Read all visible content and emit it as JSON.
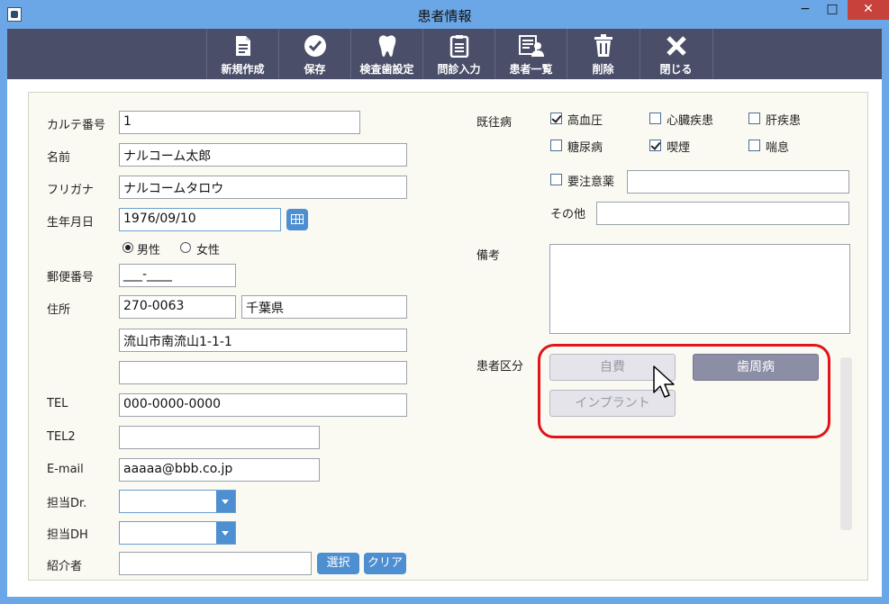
{
  "window": {
    "title": "患者情報"
  },
  "titlebar": {
    "minimize": "−",
    "maximize": "□",
    "close": "✕"
  },
  "toolbar": {
    "items": [
      {
        "label": "新規作成",
        "icon": "new-document-icon"
      },
      {
        "label": "保存",
        "icon": "check-circle-icon"
      },
      {
        "label": "検査歯設定",
        "icon": "tooth-icon"
      },
      {
        "label": "問診入力",
        "icon": "clipboard-icon"
      },
      {
        "label": "患者一覧",
        "icon": "patient-list-icon"
      },
      {
        "label": "削除",
        "icon": "trash-icon"
      },
      {
        "label": "閉じる",
        "icon": "close-x-icon"
      }
    ]
  },
  "form": {
    "chart_no": {
      "label": "カルテ番号",
      "value": "1"
    },
    "name": {
      "label": "名前",
      "value": "ナルコーム太郎"
    },
    "furigana": {
      "label": "フリガナ",
      "value": "ナルコームタロウ"
    },
    "birthdate": {
      "label": "生年月日",
      "value": "1976/09/10"
    },
    "gender": {
      "male": "男性",
      "female": "女性",
      "selected": "男性"
    },
    "postal_code": {
      "label": "郵便番号",
      "value": "___-____"
    },
    "address": {
      "label": "住所",
      "zip": "270-0063",
      "prefecture": "千葉県",
      "line1": "流山市南流山1-1-1",
      "line2": ""
    },
    "tel": {
      "label": "TEL",
      "value": "000-0000-0000"
    },
    "tel2": {
      "label": "TEL2",
      "value": ""
    },
    "email": {
      "label": "E-mail",
      "value": "aaaaa@bbb.co.jp"
    },
    "doctor": {
      "label": "担当Dr.",
      "value": ""
    },
    "hygienist": {
      "label": "担当DH",
      "value": ""
    },
    "referrer": {
      "label": "紹介者",
      "value": "",
      "select": "選択",
      "clear": "クリア"
    }
  },
  "history": {
    "label": "既往病",
    "items": [
      {
        "label": "高血圧",
        "checked": true
      },
      {
        "label": "心臓疾患",
        "checked": false
      },
      {
        "label": "肝疾患",
        "checked": false
      },
      {
        "label": "糖尿病",
        "checked": false
      },
      {
        "label": "喫煙",
        "checked": true
      },
      {
        "label": "喘息",
        "checked": false
      }
    ],
    "caution": {
      "label": "要注意薬",
      "checked": false,
      "value": ""
    },
    "other": {
      "label": "その他",
      "value": ""
    }
  },
  "remarks": {
    "label": "備考",
    "value": ""
  },
  "category": {
    "label": "患者区分",
    "buttons": [
      {
        "label": "自費",
        "active": false
      },
      {
        "label": "歯周病",
        "active": true
      },
      {
        "label": "インプラント",
        "active": false
      }
    ]
  },
  "colors": {
    "titlebar": "#6ba7e6",
    "toolbar": "#4a4e68",
    "accent": "#4d8fd0",
    "highlight": "#e1141b",
    "active_category": "#8b8ea4"
  }
}
